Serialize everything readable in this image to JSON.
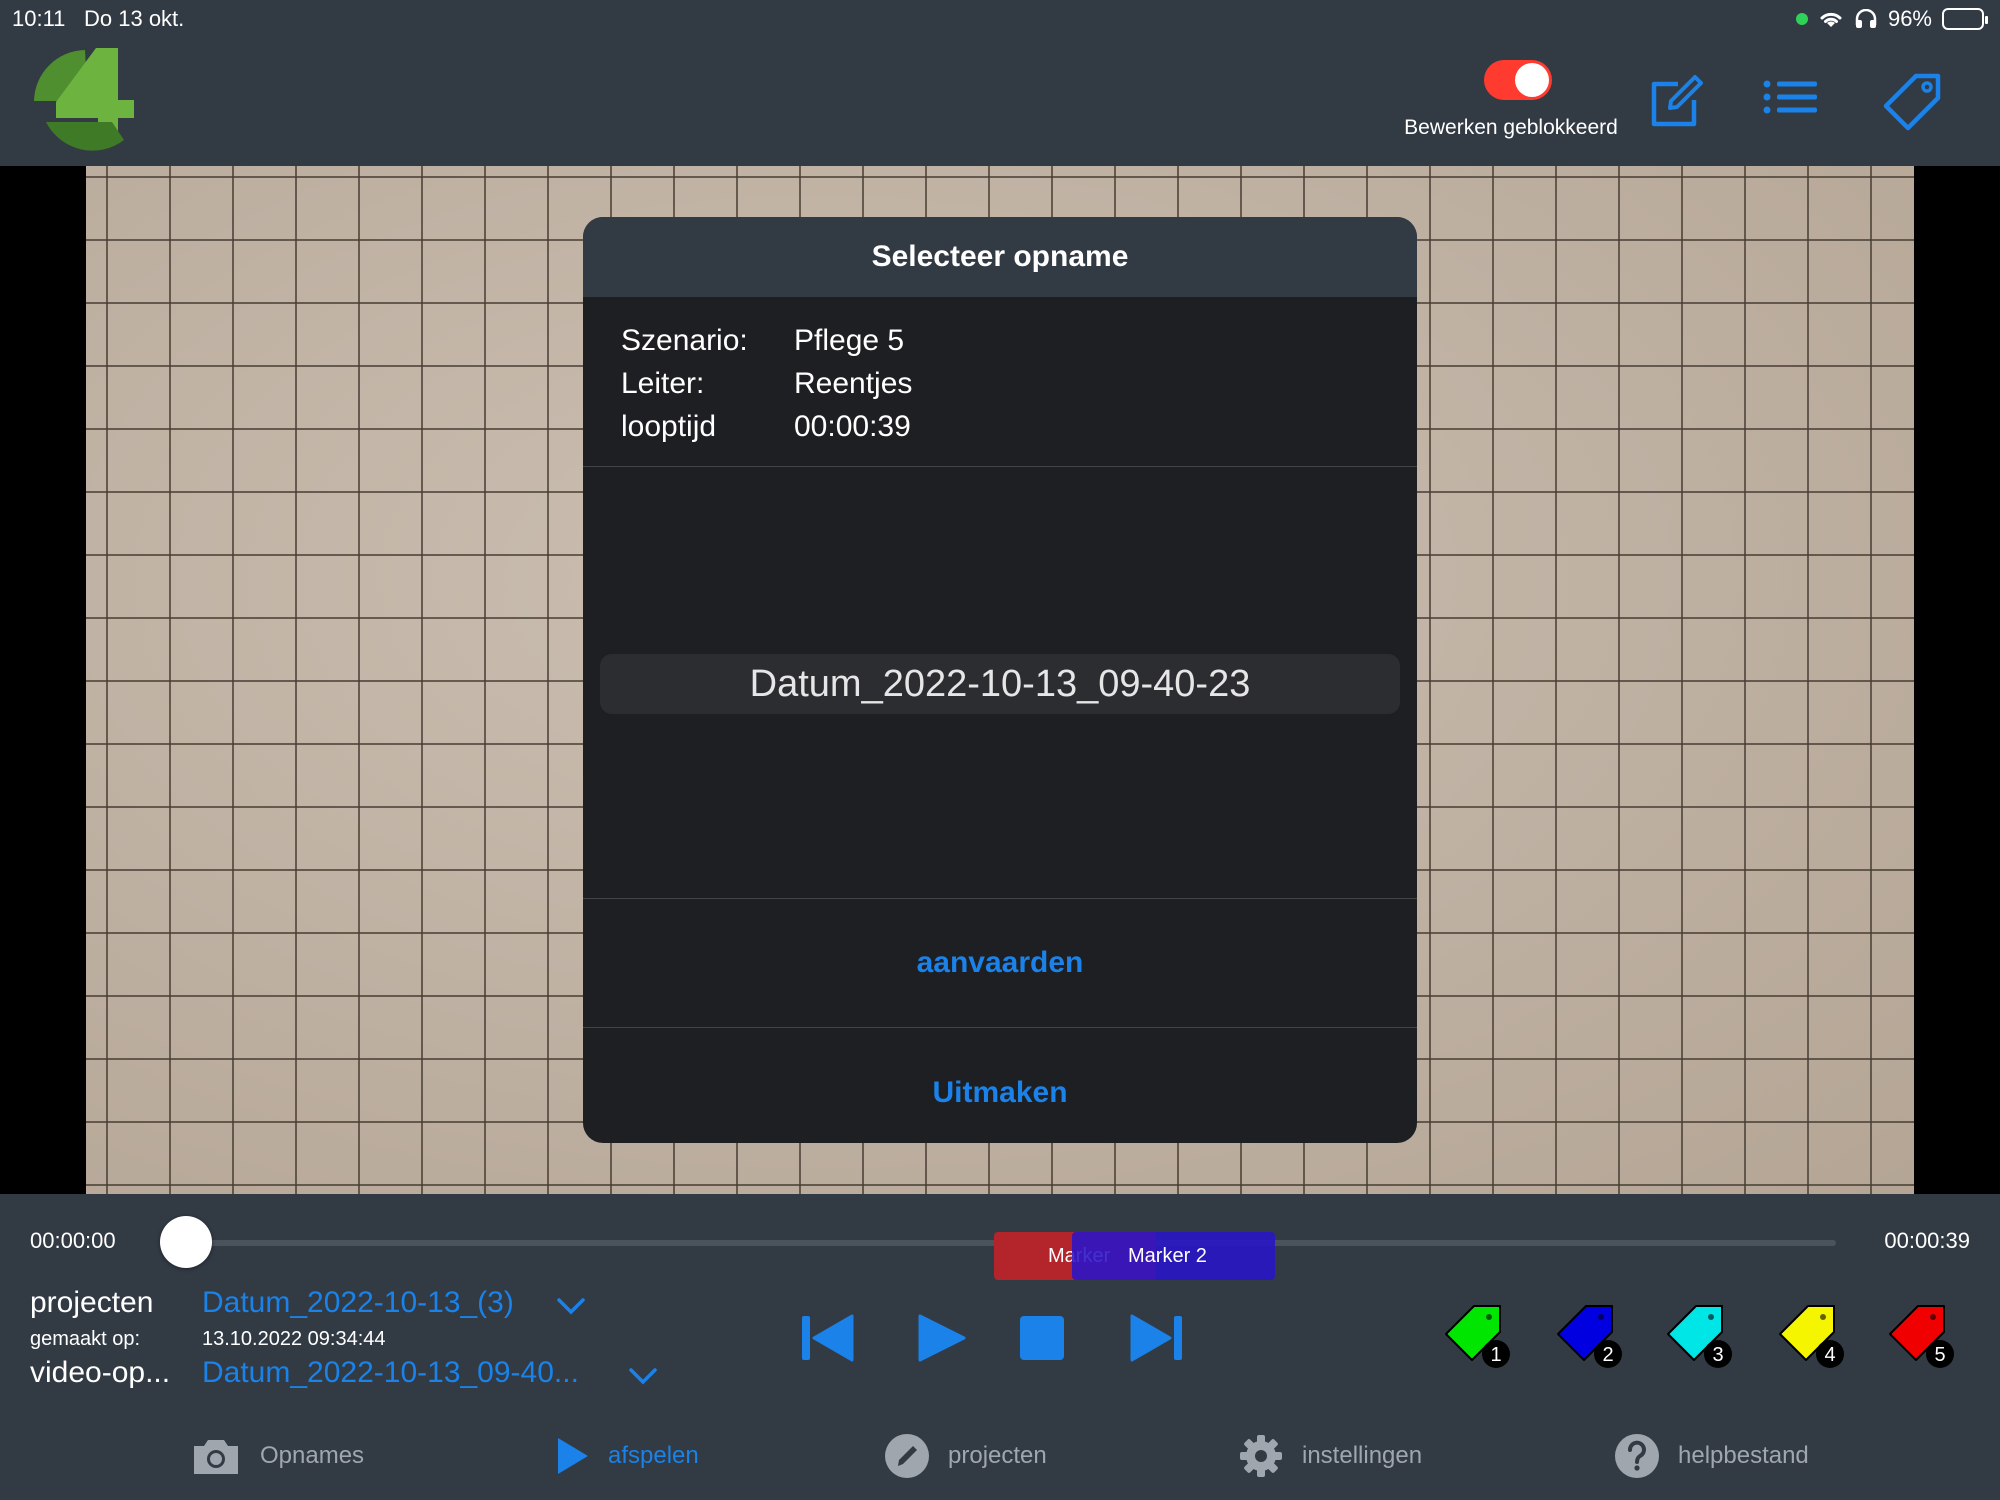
{
  "status_bar": {
    "time": "10:11",
    "date": "Do 13 okt.",
    "battery": "96%"
  },
  "header": {
    "toggle_label": "Bewerken geblokkeerd",
    "toggle_on": true,
    "colors": {
      "toggle": "#ff3b30",
      "accent": "#1a82e8",
      "logo": "#5fa33a"
    }
  },
  "modal": {
    "title": "Selecteer opname",
    "info": [
      {
        "label": "Szenario:",
        "value": "Pflege 5"
      },
      {
        "label": "Leiter:",
        "value": "Reentjes"
      },
      {
        "label": "looptijd",
        "value": "00:00:39"
      }
    ],
    "picker_selected": "Datum_2022-10-13_09-40-23",
    "accept_label": "aanvaarden",
    "cancel_label": "Uitmaken"
  },
  "player": {
    "time_start": "00:00:00",
    "time_end": "00:00:39",
    "position_fraction": 0.0,
    "markers": [
      {
        "label": "Marker",
        "color": "#b3252a"
      },
      {
        "label": "Marker 2",
        "color": "#2814c8"
      }
    ]
  },
  "meta": {
    "projects_label": "projecten",
    "projects_value": "Datum_2022-10-13_(3)",
    "created_label": "gemaakt op:",
    "created_value": "13.10.2022 09:34:44",
    "video_label": "video-op...",
    "video_value": "Datum_2022-10-13_09-40..."
  },
  "tags": [
    {
      "number": "1",
      "color": "#00e600"
    },
    {
      "number": "2",
      "color": "#0000e0"
    },
    {
      "number": "3",
      "color": "#00e5e5"
    },
    {
      "number": "4",
      "color": "#f5f500"
    },
    {
      "number": "5",
      "color": "#f00000"
    }
  ],
  "tabbar": {
    "tabs": [
      {
        "label": "Opnames",
        "icon": "camera-icon"
      },
      {
        "label": "afspelen",
        "icon": "play-icon",
        "active": true
      },
      {
        "label": "projecten",
        "icon": "pencil-icon"
      },
      {
        "label": "instellingen",
        "icon": "gear-icon"
      },
      {
        "label": "helpbestand",
        "icon": "help-icon"
      }
    ]
  }
}
